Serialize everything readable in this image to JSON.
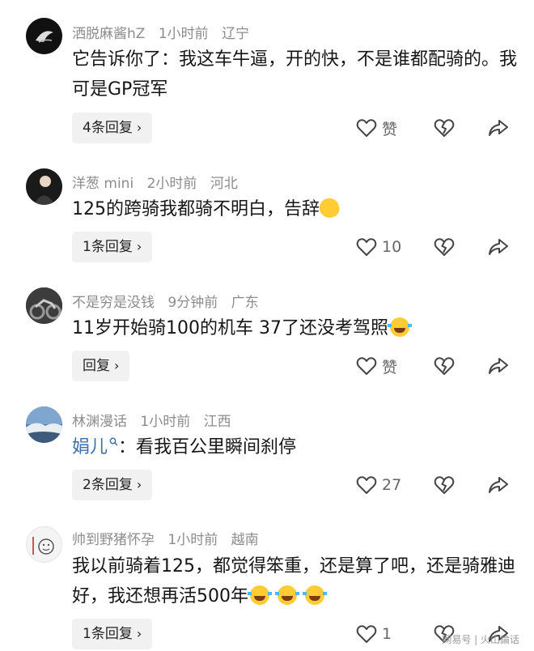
{
  "comments": [
    {
      "username": "洒脱麻酱hZ",
      "time": "1小时前",
      "location": "辽宁",
      "text": "它告诉你了：我这车牛逼，开的快，不是谁都配骑的。我可是GP冠军",
      "reply_label": "4条回复",
      "like_label": "赞"
    },
    {
      "username": "洋葱 mini",
      "time": "2小时前",
      "location": "河北",
      "text": "125的跨骑我都骑不明白，告辞",
      "reply_label": "1条回复",
      "like_label": "10"
    },
    {
      "username": "不是穷是没钱",
      "time": "9分钟前",
      "location": "广东",
      "text": "11岁开始骑100的机车 37了还没考驾照",
      "reply_label": "回复",
      "like_label": "赞"
    },
    {
      "username": "林渊漫话",
      "time": "1小时前",
      "location": "江西",
      "mention": "娟儿",
      "text": "：看我百公里瞬间刹停",
      "reply_label": "2条回复",
      "like_label": "27"
    },
    {
      "username": "帅到野猪怀孕",
      "time": "1小时前",
      "location": "越南",
      "text": "我以前骑着125，都觉得笨重，还是算了吧，还是骑雅迪好，我还想再活500年",
      "reply_label": "1条回复",
      "like_label": "1"
    }
  ],
  "watermark": "网易号 | 火山論话",
  "icons": {
    "like": "heart-outline-icon",
    "dislike": "broken-heart-icon",
    "share": "share-arrow-icon",
    "chevron": "chevron-right-icon"
  }
}
